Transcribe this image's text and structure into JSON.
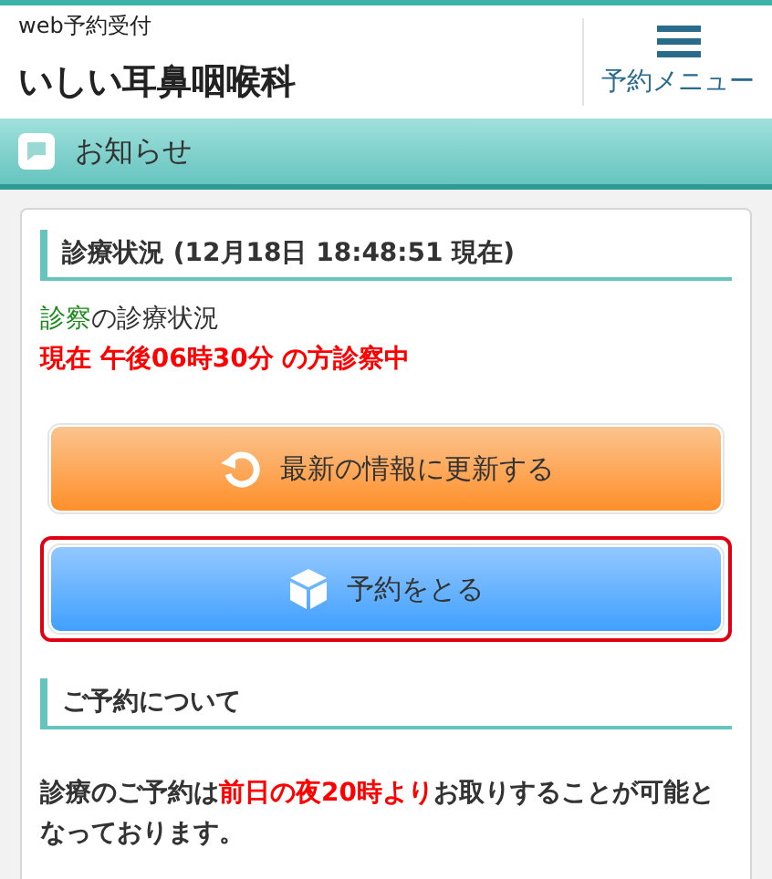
{
  "header": {
    "subtitle": "web予約受付",
    "clinic_name": "いしい耳鼻咽喉科",
    "menu_label": "予約メニュー"
  },
  "notice_bar": {
    "title": "お知らせ"
  },
  "status_section": {
    "heading": "診療状況 (12月18日 18:48:51 現在)",
    "department": "診察",
    "status_suffix": "の診療状況",
    "current": "現在 午後06時30分 の方診察中"
  },
  "buttons": [
    {
      "kind": "refresh",
      "label": "最新の情報に更新する",
      "focused": false
    },
    {
      "kind": "reserve",
      "label": "予約をとる",
      "focused": true
    }
  ],
  "reservation_section": {
    "heading": "ご予約について",
    "paragraph": [
      {
        "text": "診療のご予約は",
        "highlight": false
      },
      {
        "text": "前日の夜20時より",
        "highlight": true
      },
      {
        "text": "お取りすることが可能となっております。",
        "highlight": false
      }
    ]
  }
}
